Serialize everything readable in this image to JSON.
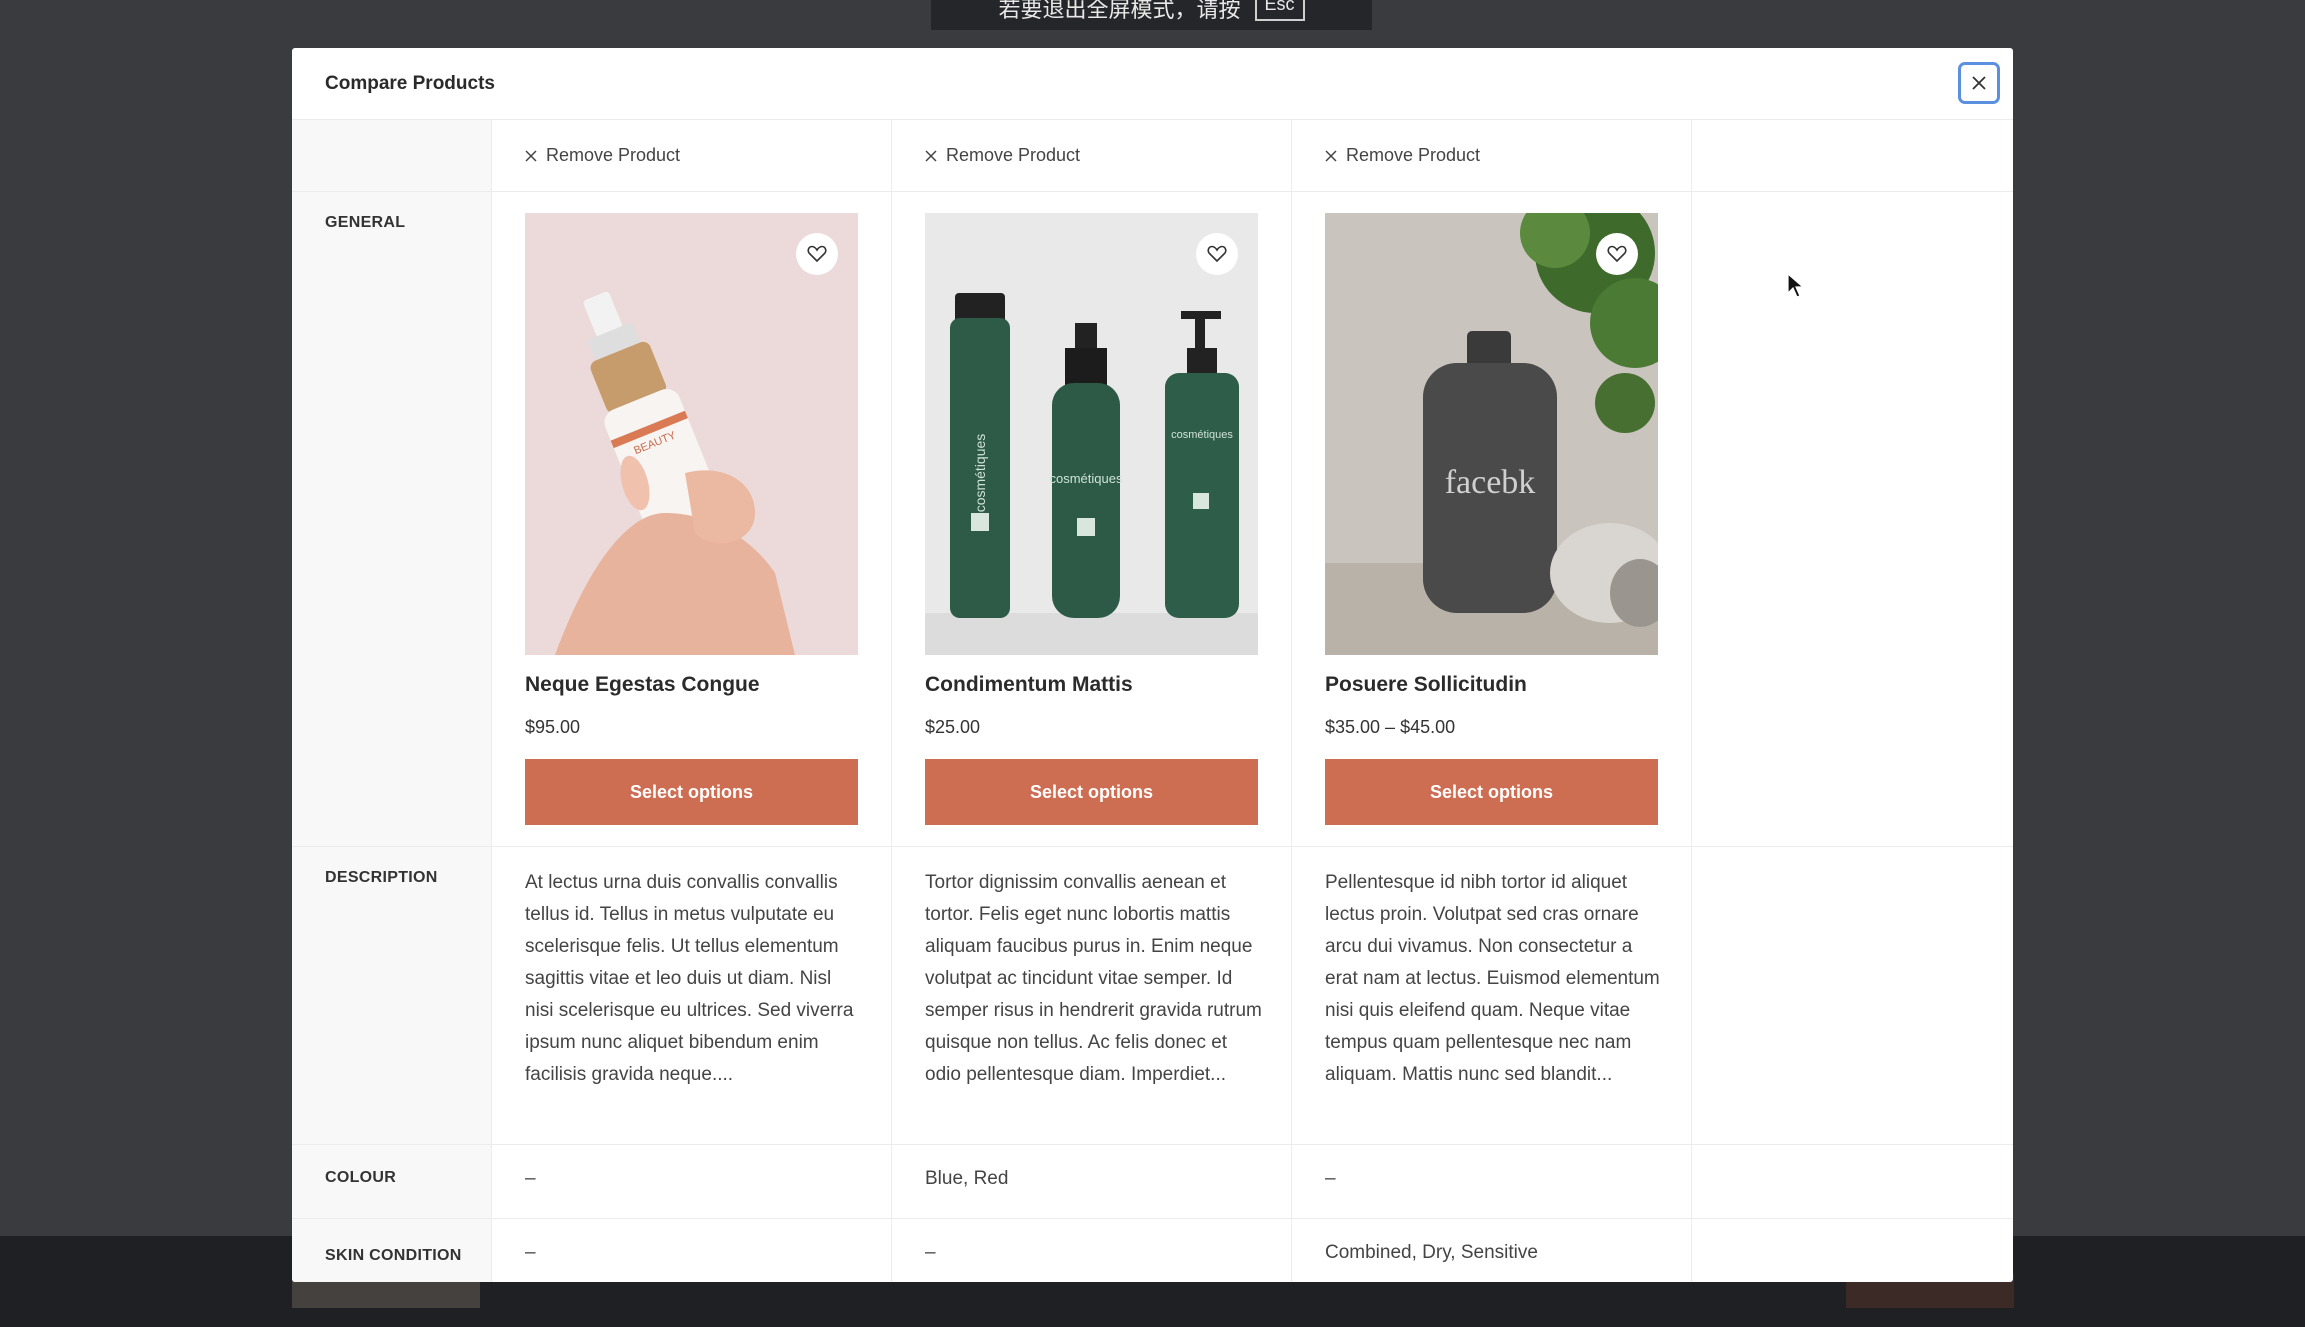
{
  "background": {
    "banner_hint": "若要退出全屏模式，请按",
    "banner_key": "Esc"
  },
  "modal": {
    "title": "Compare Products",
    "remove_label": "Remove Product",
    "select_label": "Select options",
    "rows": {
      "general": "GENERAL",
      "description": "DESCRIPTION",
      "colour": "COLOUR",
      "skin": "SKIN CONDITION"
    }
  },
  "products": [
    {
      "name": "Neque Egestas Congue",
      "price": "$95.00",
      "description": "At lectus urna duis convallis convallis tellus id. Tellus in metus vulputate eu scelerisque felis. Ut tellus elementum sagittis vitae et leo duis ut diam. Nisl nisi scelerisque eu ultrices. Sed viverra ipsum nunc aliquet bibendum enim facilisis gravida neque....",
      "colour": "–",
      "skin": "–",
      "bottle_label": "BEAUTY"
    },
    {
      "name": "Condimentum Mattis",
      "price": "$25.00",
      "description": "Tortor dignissim convallis aenean et tortor. Felis eget nunc lobortis mattis aliquam faucibus purus in. Enim neque volutpat ac tincidunt vitae semper. Id semper risus in hendrerit gravida rutrum quisque non tellus. Ac felis donec et odio pellentesque diam. Imperdiet...",
      "colour": "Blue, Red",
      "skin": "–",
      "bottle_label": "cosmétiques"
    },
    {
      "name": "Posuere Sollicitudin",
      "price": "$35.00 – $45.00",
      "description": "Pellentesque id nibh tortor id aliquet lectus proin. Volutpat sed cras ornare arcu dui vivamus. Non consectetur a erat nam at lectus. Euismod elementum nisi quis eleifend quam. Neque vitae tempus quam pellentesque nec nam aliquam. Mattis nunc sed blandit...",
      "colour": "–",
      "skin": "Combined, Dry, Sensitive",
      "bottle_label": "facebk"
    }
  ],
  "colors": {
    "accent_button": "#cd6d52",
    "focus_ring": "#5b8fe0",
    "backdrop": "#3a3b3e"
  }
}
